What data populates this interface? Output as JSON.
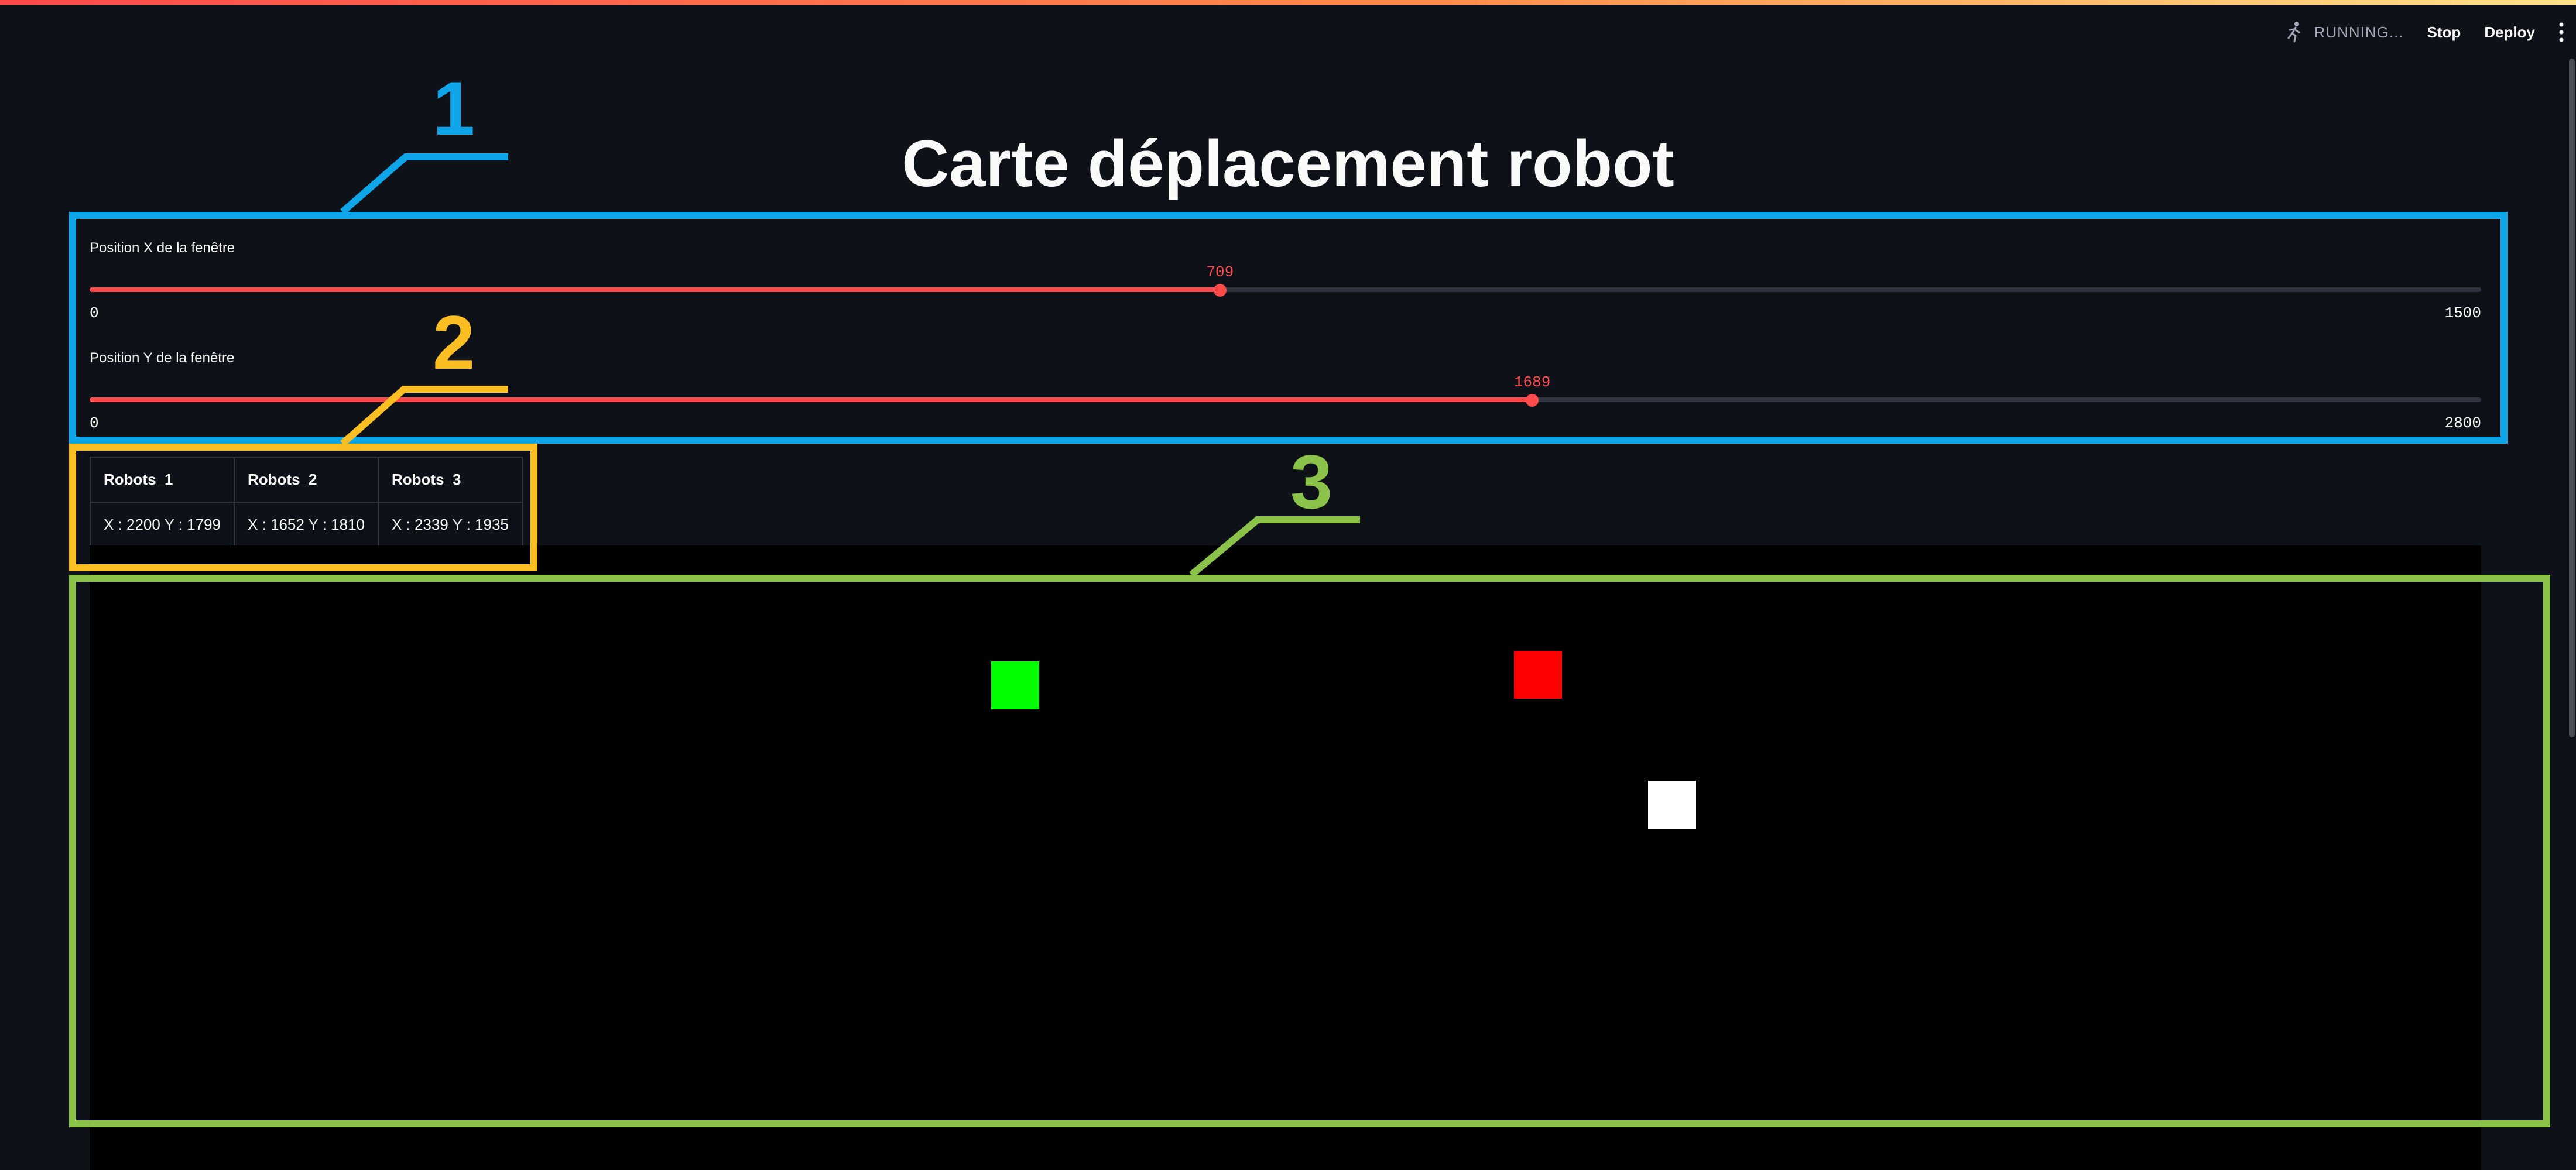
{
  "header": {
    "status": "RUNNING...",
    "stop_label": "Stop",
    "deploy_label": "Deploy",
    "running_icon": "running-man-icon",
    "menu_icon": "vertical-dots-icon"
  },
  "title": "Carte déplacement robot",
  "sliders": [
    {
      "label": "Position X de la fenêtre",
      "value": 709,
      "value_text": "709",
      "min": 0,
      "max": 1500,
      "min_text": "0",
      "max_text": "1500"
    },
    {
      "label": "Position Y de la fenêtre",
      "value": 1689,
      "value_text": "1689",
      "min": 0,
      "max": 2800,
      "min_text": "0",
      "max_text": "2800"
    }
  ],
  "table": {
    "headers": [
      "Robots_1",
      "Robots_2",
      "Robots_3"
    ],
    "row": [
      "X : 2200 Y : 1799",
      "X : 1652 Y : 1810",
      "X : 2339 Y : 1935"
    ]
  },
  "robots": [
    {
      "name": "Robots_1",
      "color": "#ff0000"
    },
    {
      "name": "Robots_2",
      "color": "#00ff00"
    },
    {
      "name": "Robots_3",
      "color": "#ffffff"
    }
  ],
  "annotations": [
    {
      "number": "1",
      "color": "#0ea5e9"
    },
    {
      "number": "2",
      "color": "#fbbf24"
    },
    {
      "number": "3",
      "color": "#8bc34a"
    }
  ],
  "colors": {
    "background": "#0e1117",
    "accent": "#ff4b4b",
    "track": "#31333f",
    "canvas": "#000000"
  }
}
